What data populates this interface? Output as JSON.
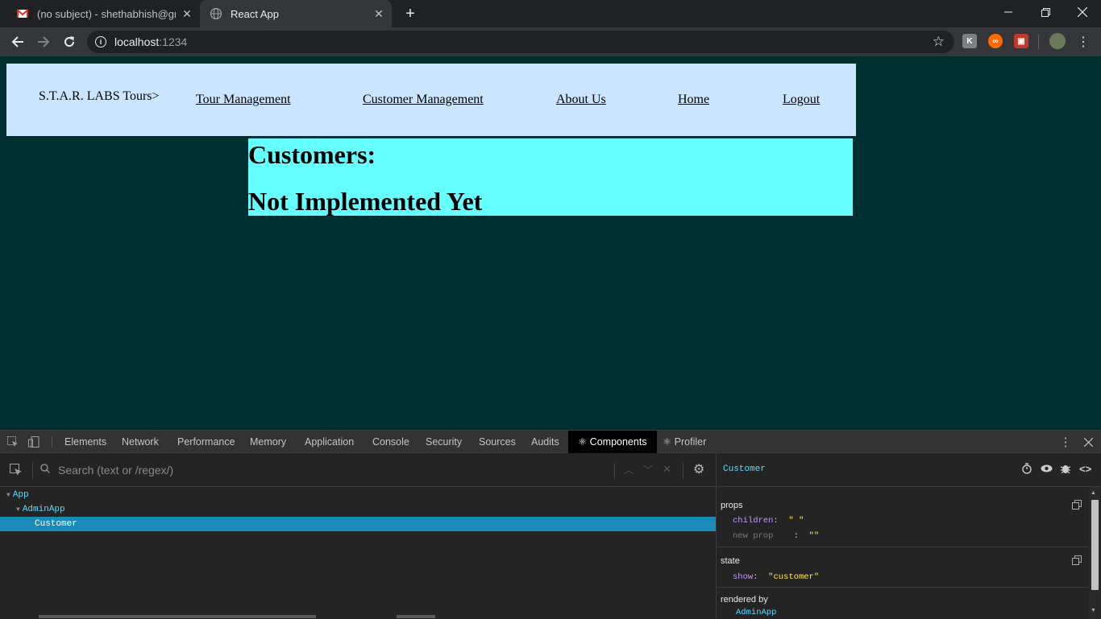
{
  "browser": {
    "tabs": [
      {
        "title": "(no subject) - shethabhish@gmai",
        "favicon": "gmail-icon"
      },
      {
        "title": "React App",
        "favicon": "globe-icon"
      }
    ],
    "url_host": "localhost",
    "url_port": ":1234",
    "window_controls": [
      "minimize",
      "restore",
      "close"
    ]
  },
  "page": {
    "brand": "S.T.A.R. LABS Tours>",
    "nav": [
      "Tour Management",
      "Customer Management",
      "About Us",
      "Home",
      "Logout"
    ],
    "heading": "Customers:",
    "subheading": "Not Implemented Yet",
    "colors": {
      "background": "#002f32",
      "navbar": "#cce5ff",
      "content": "#66ffff"
    }
  },
  "devtools": {
    "tabs": [
      "Elements",
      "Network",
      "Performance",
      "Memory",
      "Application",
      "Console",
      "Security",
      "Sources",
      "Audits",
      "⚛ Components",
      "⚛ Profiler"
    ],
    "active_tab": "⚛ Components",
    "search_placeholder": "Search (text or /regex/)",
    "tree": [
      {
        "name": "App",
        "depth": 0,
        "expanded": true
      },
      {
        "name": "AdminApp",
        "depth": 1,
        "expanded": true
      },
      {
        "name": "Customer",
        "depth": 2,
        "selected": true
      }
    ],
    "selected_component": "Customer",
    "props_title": "props",
    "props": [
      {
        "key": "children",
        "sep": ":",
        "value": "\" \""
      },
      {
        "key": "new prop",
        "sep": ":",
        "value": "\"\""
      }
    ],
    "state_title": "state",
    "state": [
      {
        "key": "show",
        "sep": ":",
        "value": "\"customer\""
      }
    ],
    "rendered_by_title": "rendered by",
    "rendered_by": "AdminApp"
  }
}
